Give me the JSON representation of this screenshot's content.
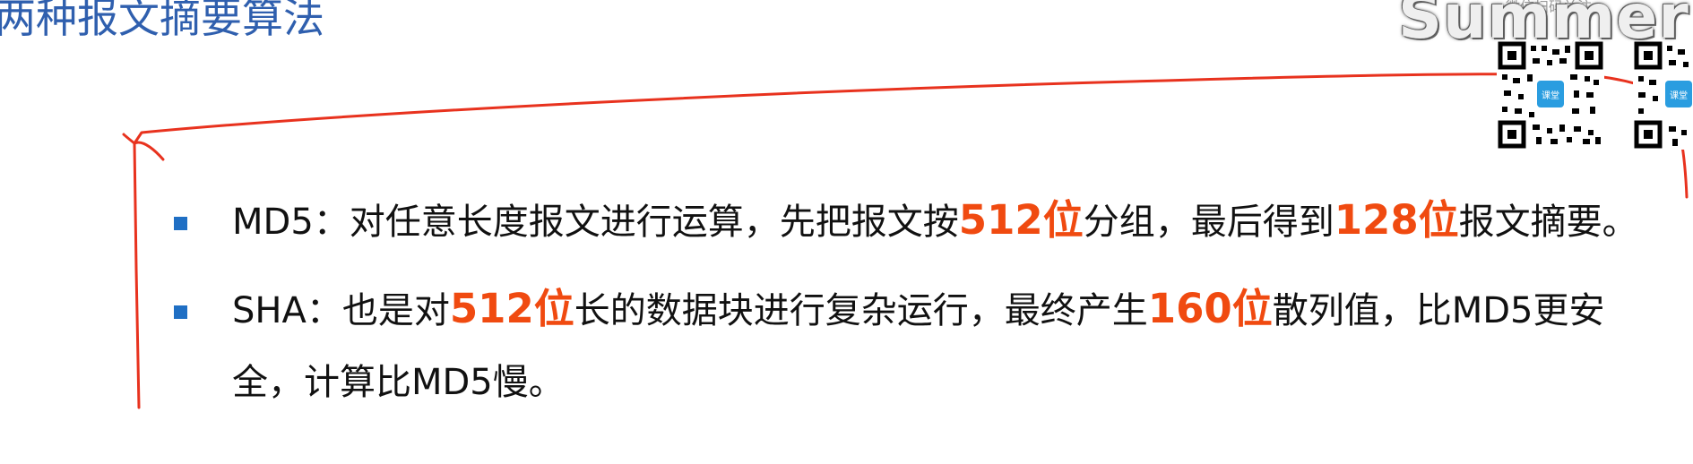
{
  "slide": {
    "title": "两种报文摘要算法"
  },
  "bullets": [
    {
      "parts": [
        {
          "text": "MD5：对任意长度报文进行运算，先把报文按",
          "highlight": false
        },
        {
          "text": "512位",
          "highlight": true
        },
        {
          "text": "分组，最后得到",
          "highlight": false
        },
        {
          "text": "128位",
          "highlight": true
        },
        {
          "text": "报文摘要。",
          "highlight": false
        }
      ]
    },
    {
      "parts": [
        {
          "text": "SHA：也是对",
          "highlight": false
        },
        {
          "text": "512位",
          "highlight": true
        },
        {
          "text": "长的数据块进行复杂运行，最终产生",
          "highlight": false
        },
        {
          "text": "160位",
          "highlight": true
        },
        {
          "text": "散列值，比MD5更安",
          "highlight": false
        }
      ],
      "continuation": "全，计算比MD5慢。"
    }
  ],
  "overlay": {
    "watermark_text": "Summer",
    "top_note": "微信扫码关注",
    "qr_badge_label": "课堂"
  },
  "colors": {
    "title": "#2f5fae",
    "bullet": "#1f6fc4",
    "highlight": "#f04a10",
    "pen": "#e8321e"
  }
}
